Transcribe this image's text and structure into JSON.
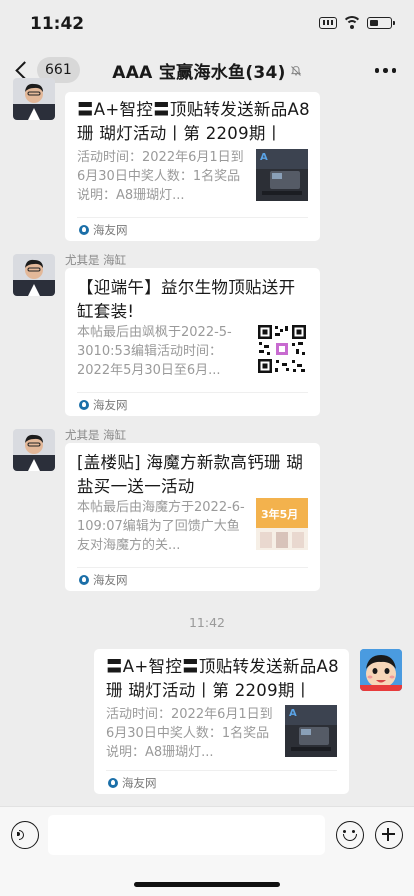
{
  "status_bar": {
    "time": "11:42"
  },
  "nav": {
    "back_badge": "661",
    "title": "AAA 宝赢海水鱼(34)"
  },
  "messages": [
    {
      "sender": "",
      "title": "〓A+智控〓顶贴转发送新品A8珊 瑚灯活动丨第 2209期丨",
      "desc": "活动时间：2022年6月1日到6月30日中奖人数：1名奖品说明：A8珊瑚灯...",
      "source": "海友网"
    },
    {
      "sender": "尤其是 海缸",
      "title": "【迎端午】益尔生物顶贴送开缸套装!",
      "desc": "本帖最后由飒枫于2022-5-3010:53编辑活动时间：2022年5月30日至6月...",
      "source": "海友网"
    },
    {
      "sender": "尤其是 海缸",
      "title": "[盖楼贴] 海魔方新款高钙珊 瑚盐买一送一活动",
      "desc": "本帖最后由海魔方于2022-6-109:07编辑为了回馈广大鱼友对海魔方的关...",
      "source": "海友网"
    },
    {
      "sender": "",
      "title": "〓A+智控〓顶贴转发送新品A8珊 瑚灯活动丨第 2209期丨",
      "desc": "活动时间：2022年6月1日到6月30日中奖人数：1名奖品说明：A8珊瑚灯...",
      "source": "海友网"
    }
  ],
  "time_separator": "11:42",
  "thumb3_text": "3年5月",
  "icons": {
    "back": "chevron-left-icon",
    "mute": "bell-slash-icon",
    "more": "more-dots-icon",
    "voice": "voice-icon",
    "emoji": "emoji-icon",
    "plus": "plus-icon"
  },
  "colors": {
    "background": "#ededed",
    "card": "#ffffff",
    "input_bar": "#f7f7f7"
  }
}
